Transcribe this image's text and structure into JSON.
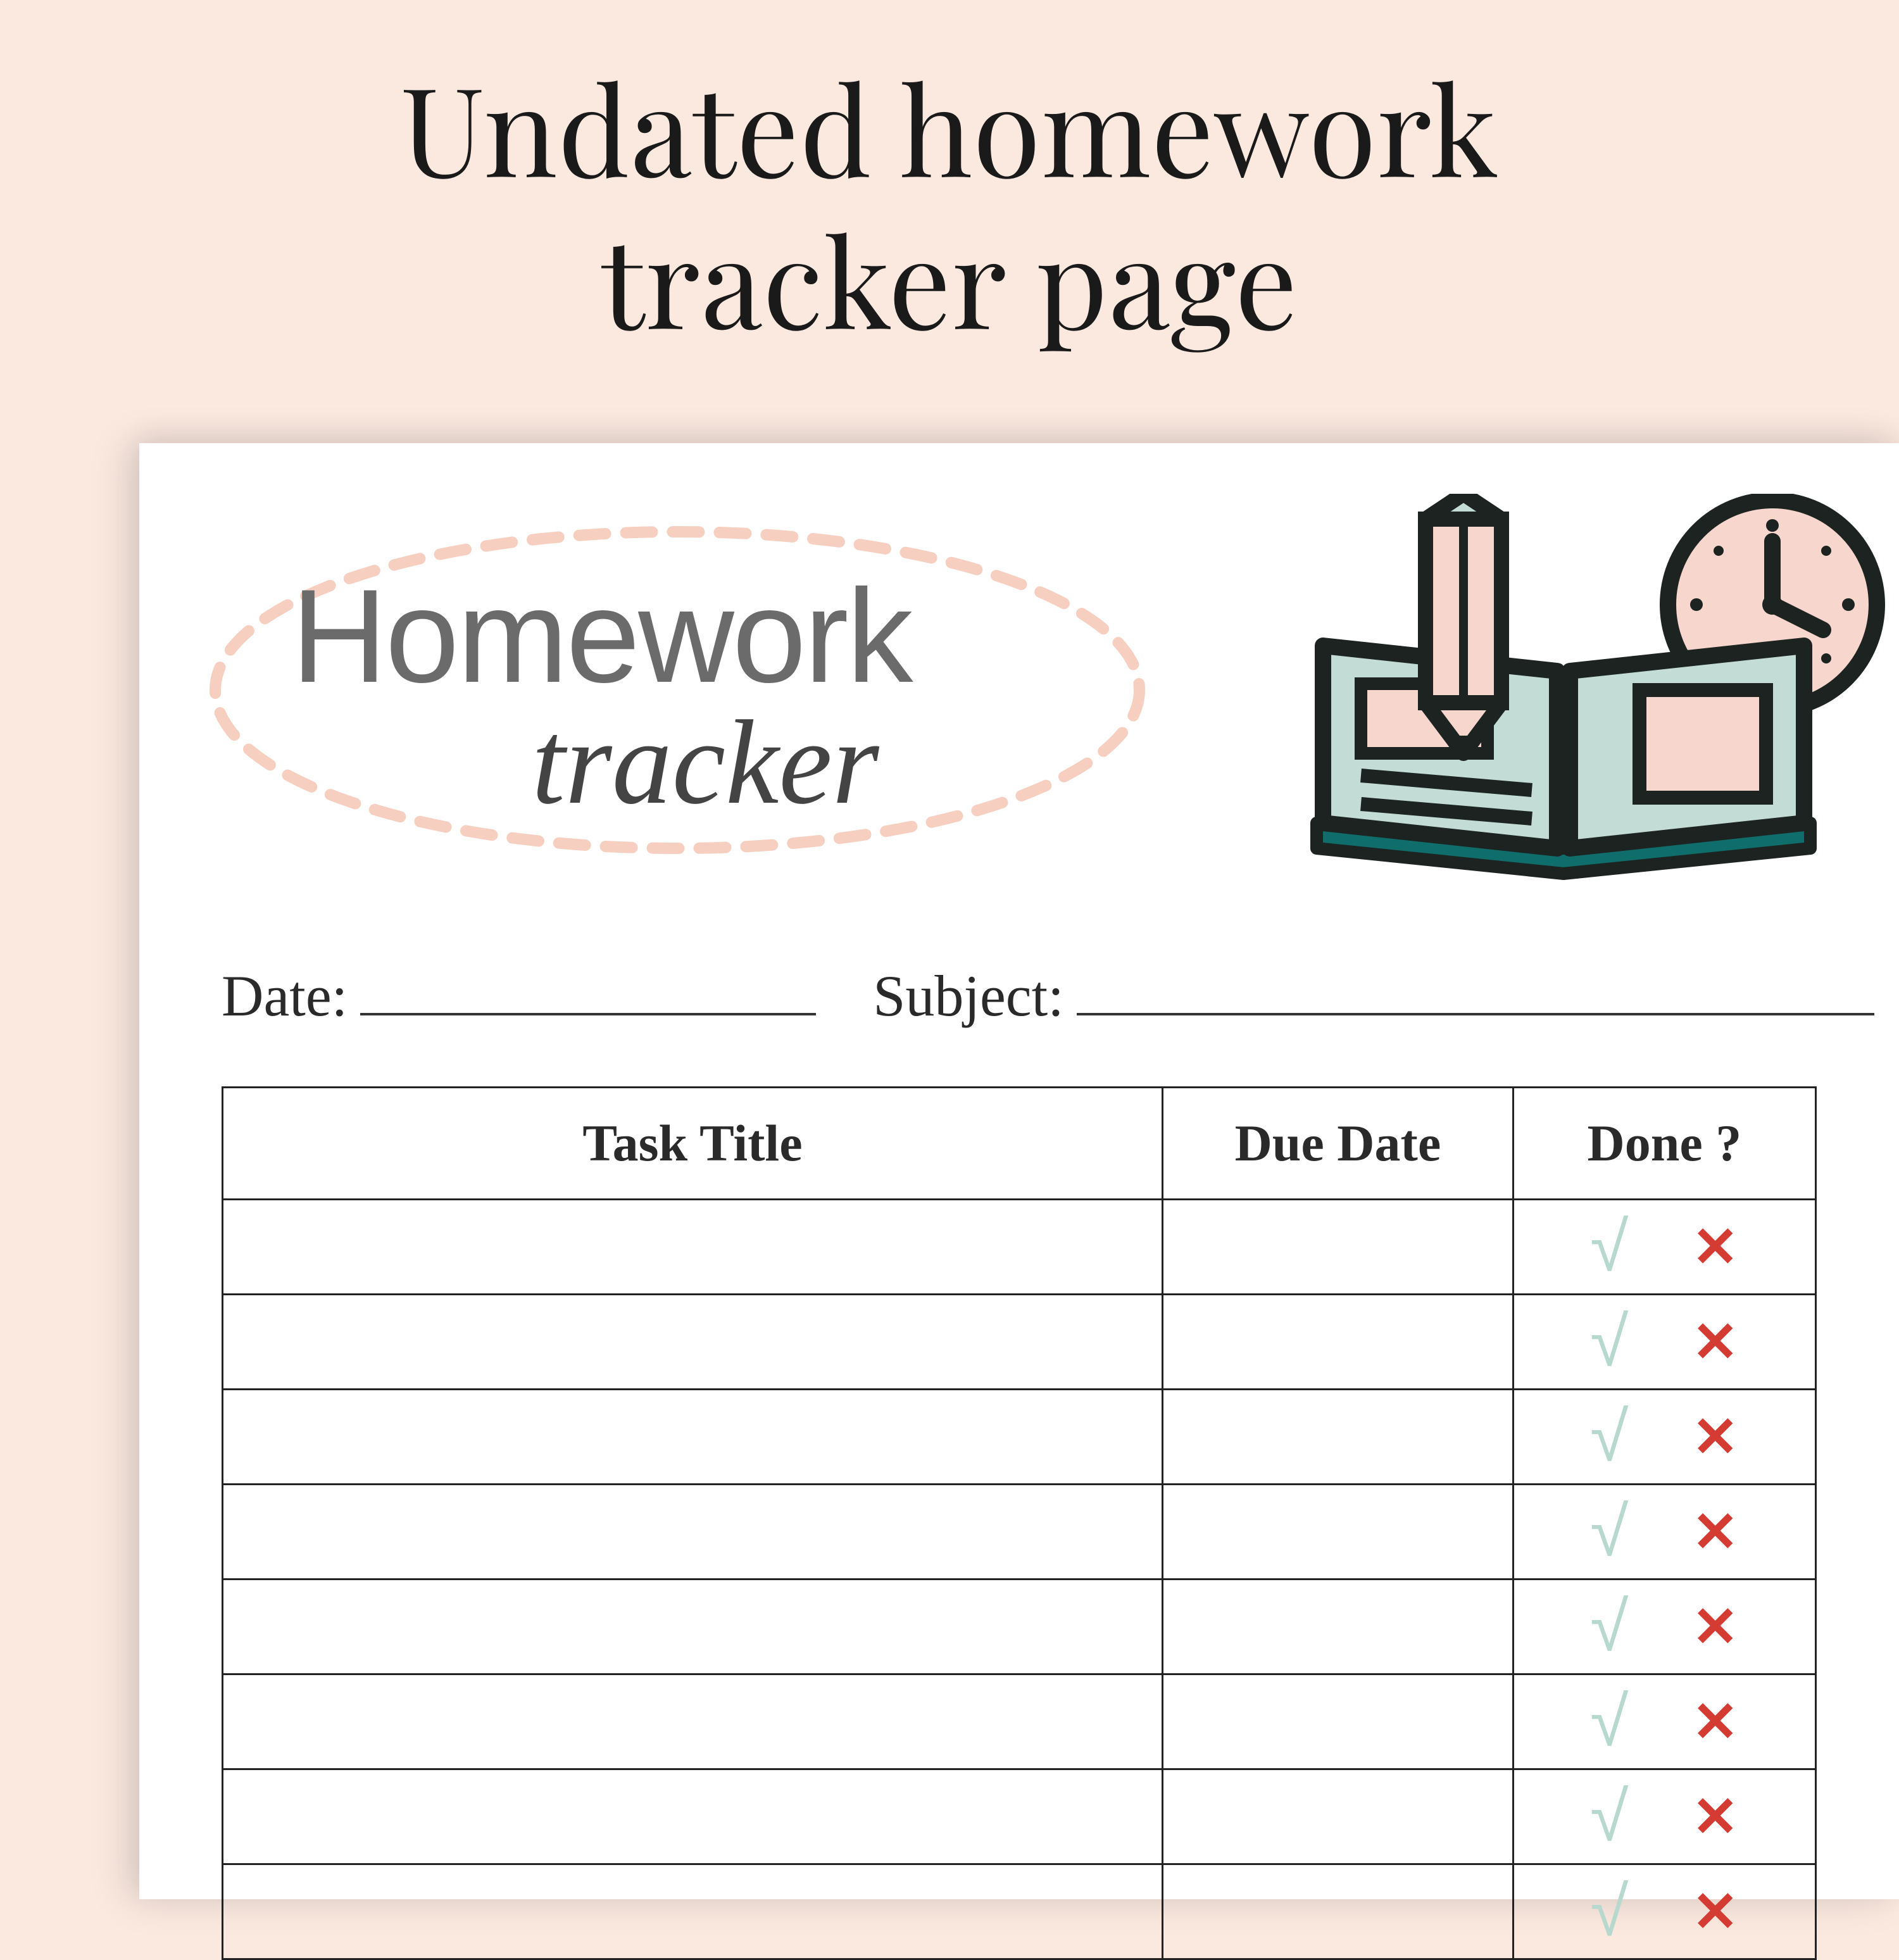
{
  "page_heading": "Undated homework\ntracker page",
  "logo": {
    "line1": "Homework",
    "line2": "tracker"
  },
  "fields": {
    "date_label": "Date:",
    "subject_label": "Subject:"
  },
  "table": {
    "headers": {
      "task": "Task Title",
      "due": "Due Date",
      "done": "Done ?"
    },
    "row_count": 8,
    "marks": {
      "check": "√",
      "cross": "✕"
    }
  },
  "colors": {
    "bg": "#fbe9e0",
    "ellipse_dash": "#f6cfc1",
    "check": "#b6d8ce",
    "cross": "#d43b33",
    "book_fill": "#c3dcd6",
    "clock_fill": "#f6d6cd",
    "pencil_fill": "#f6d6cd"
  }
}
